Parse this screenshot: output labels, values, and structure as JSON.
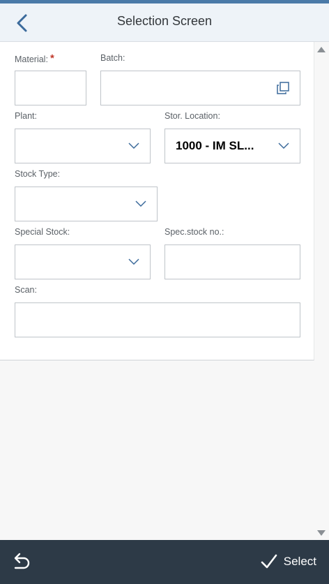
{
  "header": {
    "title": "Selection Screen"
  },
  "form": {
    "material": {
      "label": "Material:",
      "required_mark": "*",
      "value": ""
    },
    "batch": {
      "label": "Batch:",
      "value": ""
    },
    "plant": {
      "label": "Plant:",
      "value": ""
    },
    "stor_location": {
      "label": "Stor. Location:",
      "value": "1000 - IM SL..."
    },
    "stock_type": {
      "label": "Stock Type:",
      "value": ""
    },
    "special_stock": {
      "label": "Special Stock:",
      "value": ""
    },
    "spec_stock_no": {
      "label": "Spec.stock no.:",
      "value": ""
    },
    "scan": {
      "label": "Scan:",
      "value": ""
    }
  },
  "footer": {
    "select_label": "Select"
  },
  "colors": {
    "header_bg": "#eef3f8",
    "accent": "#3b6a9b",
    "footer_bg": "#2d3a47",
    "required": "#c0392b"
  },
  "icons": [
    "back-icon",
    "value-help-icon",
    "chevron-down-icon",
    "scroll-up-icon",
    "scroll-down-icon",
    "undo-icon",
    "checkmark-icon"
  ]
}
